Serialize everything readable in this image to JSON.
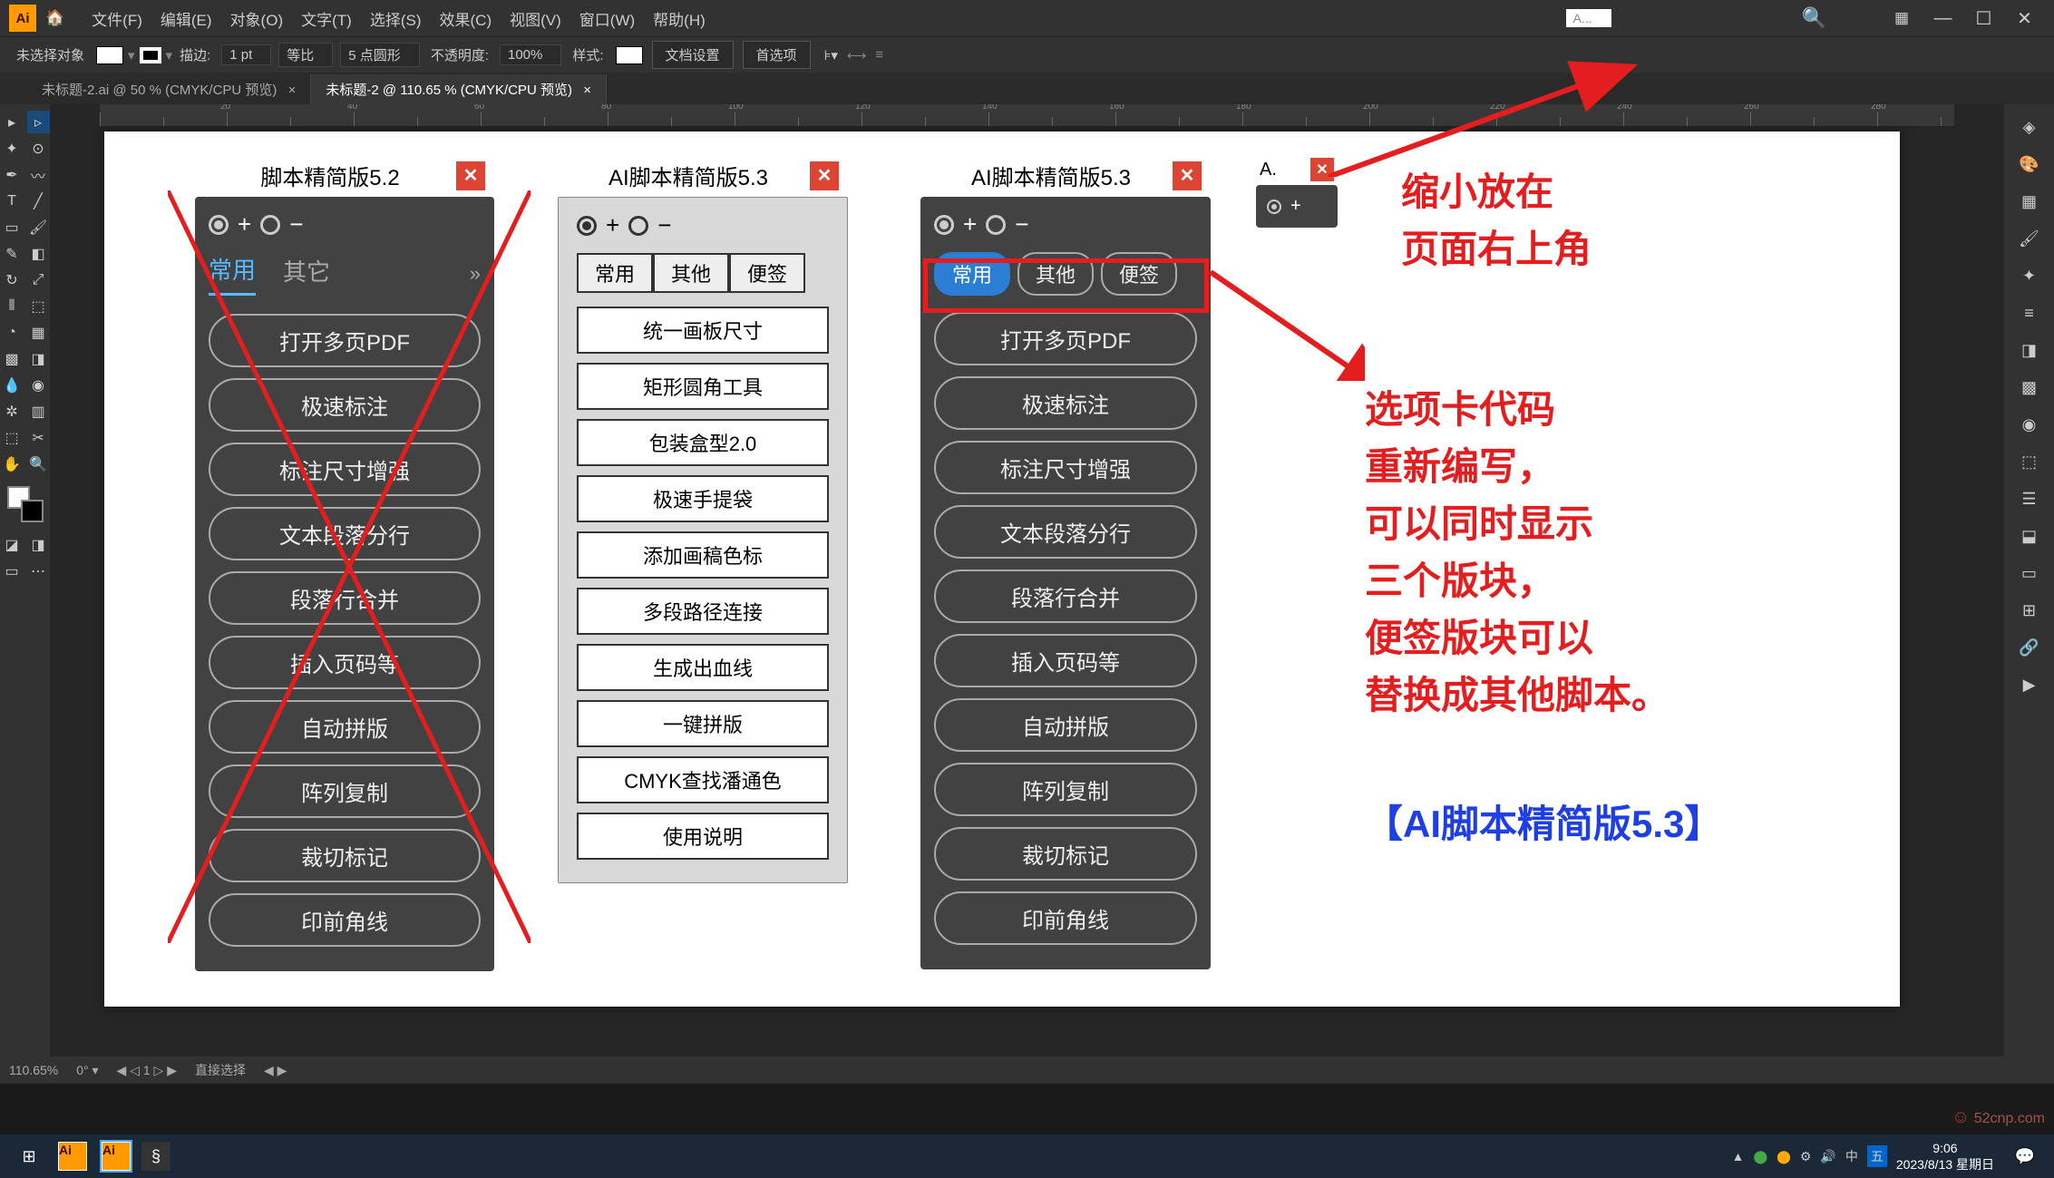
{
  "app": {
    "logo": "Ai"
  },
  "menu": {
    "items": [
      "文件(F)",
      "编辑(E)",
      "对象(O)",
      "文字(T)",
      "选择(S)",
      "效果(C)",
      "视图(V)",
      "窗口(W)",
      "帮助(H)"
    ],
    "search_placeholder": "A..."
  },
  "controlbar": {
    "no_selection": "未选择对象",
    "stroke_label": "描边:",
    "stroke_value": "1 pt",
    "uniform": "等比",
    "brush": "5 点圆形",
    "opacity_label": "不透明度:",
    "opacity_value": "100%",
    "style_label": "样式:",
    "doc_setup": "文档设置",
    "preferences": "首选项"
  },
  "tabs": [
    {
      "label": "未标题-2.ai @ 50 % (CMYK/CPU 预览)",
      "active": false
    },
    {
      "label": "未标题-2 @ 110.65 % (CMYK/CPU 预览)",
      "active": true
    }
  ],
  "panel52": {
    "title": "脚本精简版5.2",
    "tabs": {
      "t1": "常用",
      "t2": "其它"
    },
    "buttons": [
      "打开多页PDF",
      "极速标注",
      "标注尺寸增强",
      "文本段落分行",
      "段落行合并",
      "插入页码等",
      "自动拼版",
      "阵列复制",
      "裁切标记",
      "印前角线"
    ]
  },
  "panel53light": {
    "title": "AI脚本精简版5.3",
    "tabs": {
      "t1": "常用",
      "t2": "其他",
      "t3": "便签"
    },
    "buttons": [
      "统一画板尺寸",
      "矩形圆角工具",
      "包装盒型2.0",
      "极速手提袋",
      "添加画稿色标",
      "多段路径连接",
      "生成出血线",
      "一键拼版",
      "CMYK查找潘通色",
      "使用说明"
    ]
  },
  "panel53dark": {
    "title": "AI脚本精简版5.3",
    "tabs": {
      "t1": "常用",
      "t2": "其他",
      "t3": "便签"
    },
    "buttons": [
      "打开多页PDF",
      "极速标注",
      "标注尺寸增强",
      "文本段落分行",
      "段落行合并",
      "插入页码等",
      "自动拼版",
      "阵列复制",
      "裁切标记",
      "印前角线"
    ]
  },
  "mini_panel": {
    "title": "A."
  },
  "annotations": {
    "topright1": "缩小放在",
    "topright2": "页面右上角",
    "body1": "选项卡代码",
    "body2": "重新编写，",
    "body3": "可以同时显示",
    "body4": "三个版块，",
    "body5": "便签版块可以",
    "body6": "替换成其他脚本。",
    "footer": "【AI脚本精简版5.3】"
  },
  "statusbar": {
    "zoom": "110.65%",
    "nav": "1",
    "tool": "直接选择"
  },
  "taskbar": {
    "time": "9:06",
    "date": "2023/8/13 星期日"
  },
  "watermark": "52cnp.com"
}
